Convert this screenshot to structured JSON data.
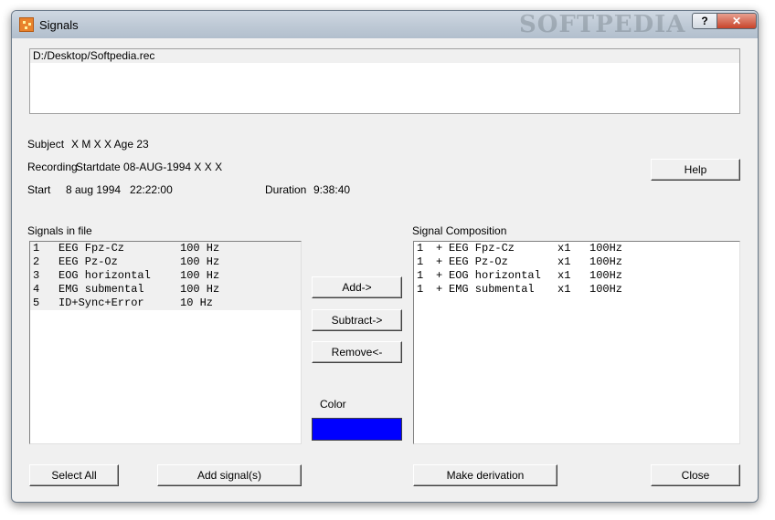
{
  "window": {
    "title": "Signals",
    "watermark": "SOFTPEDIA",
    "help_glyph": "?",
    "close_glyph": "✕"
  },
  "file_path": "D:/Desktop/Softpedia.rec",
  "info": {
    "subject_label": "Subject",
    "subject_value": "X M X X Age 23",
    "recording_label": "Recording",
    "recording_value": "Startdate 08-AUG-1994 X X X",
    "start_label": "Start",
    "start_value": "8 aug 1994   22:22:00",
    "duration_label": "Duration",
    "duration_value": "9:38:40"
  },
  "buttons": {
    "help": "Help",
    "add": "Add->",
    "subtract": "Subtract->",
    "remove": "Remove<-",
    "select_all": "Select All",
    "add_signals": "Add signal(s)",
    "make_derivation": "Make derivation",
    "close": "Close"
  },
  "signals_in_file": {
    "label": "Signals in file",
    "items": [
      {
        "num": "1",
        "name": "EEG Fpz-Cz",
        "rate": "100 Hz"
      },
      {
        "num": "2",
        "name": "EEG Pz-Oz",
        "rate": "100 Hz"
      },
      {
        "num": "3",
        "name": "EOG horizontal",
        "rate": "100 Hz"
      },
      {
        "num": "4",
        "name": "EMG submental",
        "rate": "100 Hz"
      },
      {
        "num": "5",
        "name": "ID+Sync+Error",
        "rate": "10 Hz"
      }
    ]
  },
  "signal_composition": {
    "label": "Signal Composition",
    "items": [
      {
        "num": "1",
        "sign": "+",
        "name": "EEG Fpz-Cz",
        "factor": "x1",
        "rate": "100Hz"
      },
      {
        "num": "1",
        "sign": "+",
        "name": "EEG Pz-Oz",
        "factor": "x1",
        "rate": "100Hz"
      },
      {
        "num": "1",
        "sign": "+",
        "name": "EOG horizontal",
        "factor": "x1",
        "rate": "100Hz"
      },
      {
        "num": "1",
        "sign": "+",
        "name": "EMG submental",
        "factor": "x1",
        "rate": "100Hz"
      }
    ]
  },
  "color": {
    "label": "Color",
    "value": "#0000ff"
  }
}
